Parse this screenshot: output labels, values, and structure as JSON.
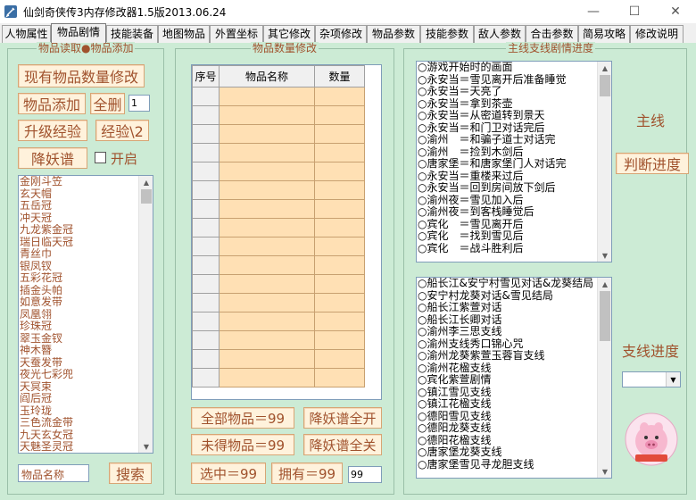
{
  "window": {
    "title": "仙剑奇侠传3内存修改器1.5版2013.06.24",
    "min_symbol": "—",
    "max_symbol": "☐",
    "close_symbol": "✕",
    "icon": "sword-app-icon"
  },
  "tabs": [
    {
      "label": "人物属性",
      "active": false
    },
    {
      "label": "物品剧情",
      "active": true
    },
    {
      "label": "技能装备",
      "active": false
    },
    {
      "label": "地图物品",
      "active": false
    },
    {
      "label": "外置坐标",
      "active": false
    },
    {
      "label": "其它修改",
      "active": false
    },
    {
      "label": "杂项修改",
      "active": false
    },
    {
      "label": "物品参数",
      "active": false
    },
    {
      "label": "技能参数",
      "active": false
    },
    {
      "label": "敌人参数",
      "active": false
    },
    {
      "label": "合击参数",
      "active": false
    },
    {
      "label": "简易攻略",
      "active": false
    },
    {
      "label": "修改说明",
      "active": false
    }
  ],
  "left_panel": {
    "title": "物品读取●物品添加",
    "btn_modify_count": "现有物品数量修改",
    "btn_add_item": "物品添加",
    "btn_delete_all": "全删",
    "count_value": "1",
    "btn_upgrade_exp": "升级经验",
    "btn_exp_half": "经验\\2",
    "btn_yaoguai": "降妖谱",
    "checkbox_label": "开启",
    "items": [
      "金刚斗笠",
      "玄天帽",
      "五岳冠",
      "冲天冠",
      "九龙紫金冠",
      "瑞日临天冠",
      "青丝巾",
      "银凤钗",
      "五彩花冠",
      "插金头帕",
      "如意发带",
      "凤凰翎",
      "珍珠冠",
      "翠玉金钗",
      "神木簪",
      "天蚕发带",
      "夜光七彩兜",
      "天冥束",
      "阎后冠",
      "玉玲珑",
      "三色流金带",
      "九天玄女冠",
      "天魅圣灵冠",
      "梦华天蚕冠"
    ],
    "search_input": "物品名称",
    "btn_search": "搜索"
  },
  "middle_panel": {
    "title": "物品数量修改",
    "col_index": "序号",
    "col_name": "物品名称",
    "col_count": "数量",
    "btn_all_items": "全部物品＝99",
    "btn_unowned_items": "未得物品＝99",
    "btn_selected": "选中＝99",
    "btn_owned": "拥有＝99",
    "value_input": "99",
    "btn_yaoguai_all_on": "降妖谱全开",
    "btn_yaoguai_all_off": "降妖谱全关"
  },
  "right_panel": {
    "title": "主线支线剧情进度",
    "main_label": "主线",
    "btn_judge": "判断进度",
    "branch_label": "支线进度",
    "main_list": [
      "○游戏开始时的画面",
      "○永安当＝雪见离开后准备睡觉",
      "○永安当＝天亮了",
      "○永安当＝拿到茶壶",
      "○永安当＝从密道转到景天",
      "○永安当＝和门卫对话完后",
      "○渝州　＝和骗子道士对话完",
      "○渝州　＝捡到木剑后",
      "○唐家堡＝和唐家堡门人对话完",
      "○永安当＝重楼来过后",
      "○永安当＝回到房间放下剑后",
      "○渝州夜＝雪见加入后",
      "○渝州夜＝到客栈睡觉后",
      "○宾化　＝雪见离开后",
      "○宾化　＝找到雪见后",
      "○宾化　＝战斗胜利后"
    ],
    "branch_list": [
      "○船长江&安宁村雪见对话&龙葵结局",
      "○安宁村龙葵对话&雪见结局",
      "○船长江紫萱对话",
      "○船长江长卿对话",
      "○渝州李三思支线",
      "○渝州支线秀口锦心咒",
      "○渝州龙葵紫萱玉蓉盲支线",
      "○渝州花楹支线",
      "○宾化紫萱剧情",
      "○镇江雪见支线",
      "○镇江花楹支线",
      "○德阳雪见支线",
      "○德阳龙葵支线",
      "○德阳花楹支线",
      "○唐家堡龙葵支线",
      "○唐家堡雪见寻龙胆支线"
    ],
    "logo": "pig-mascot-logo"
  }
}
